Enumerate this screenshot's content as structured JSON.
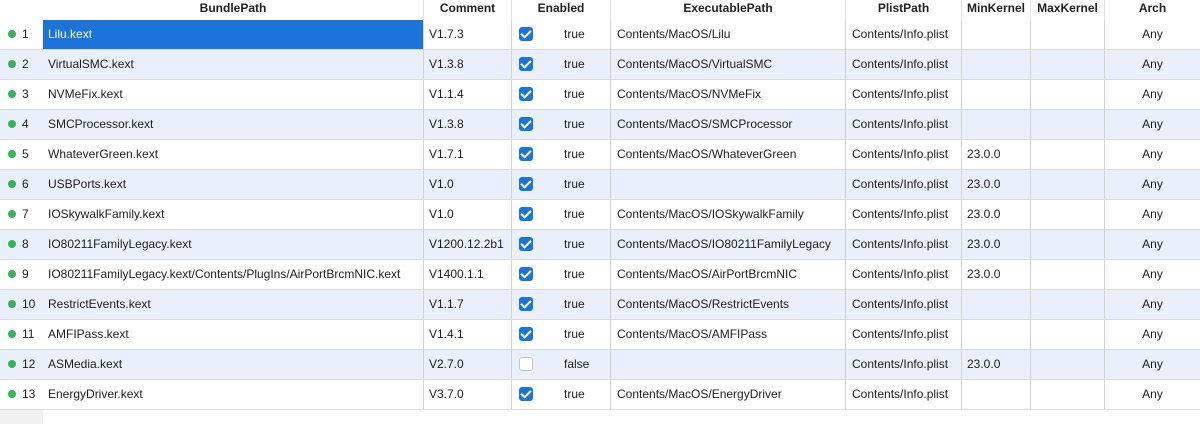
{
  "columns": [
    "BundlePath",
    "Comment",
    "Enabled",
    "ExecutablePath",
    "PlistPath",
    "MinKernel",
    "MaxKernel",
    "Arch"
  ],
  "rows": [
    {
      "index": "1",
      "bundle": "Lilu.kext",
      "comment": "V1.7.3",
      "enabled": true,
      "enabled_text": "true",
      "exec": "Contents/MacOS/Lilu",
      "plist": "Contents/Info.plist",
      "minkernel": "",
      "maxkernel": "",
      "arch": "Any"
    },
    {
      "index": "2",
      "bundle": "VirtualSMC.kext",
      "comment": "V1.3.8",
      "enabled": true,
      "enabled_text": "true",
      "exec": "Contents/MacOS/VirtualSMC",
      "plist": "Contents/Info.plist",
      "minkernel": "",
      "maxkernel": "",
      "arch": "Any"
    },
    {
      "index": "3",
      "bundle": "NVMeFix.kext",
      "comment": "V1.1.4",
      "enabled": true,
      "enabled_text": "true",
      "exec": "Contents/MacOS/NVMeFix",
      "plist": "Contents/Info.plist",
      "minkernel": "",
      "maxkernel": "",
      "arch": "Any"
    },
    {
      "index": "4",
      "bundle": "SMCProcessor.kext",
      "comment": "V1.3.8",
      "enabled": true,
      "enabled_text": "true",
      "exec": "Contents/MacOS/SMCProcessor",
      "plist": "Contents/Info.plist",
      "minkernel": "",
      "maxkernel": "",
      "arch": "Any"
    },
    {
      "index": "5",
      "bundle": "WhateverGreen.kext",
      "comment": "V1.7.1",
      "enabled": true,
      "enabled_text": "true",
      "exec": "Contents/MacOS/WhateverGreen",
      "plist": "Contents/Info.plist",
      "minkernel": "23.0.0",
      "maxkernel": "",
      "arch": "Any"
    },
    {
      "index": "6",
      "bundle": "USBPorts.kext",
      "comment": "V1.0",
      "enabled": true,
      "enabled_text": "true",
      "exec": "",
      "plist": "Contents/Info.plist",
      "minkernel": "23.0.0",
      "maxkernel": "",
      "arch": "Any"
    },
    {
      "index": "7",
      "bundle": "IOSkywalkFamily.kext",
      "comment": "V1.0",
      "enabled": true,
      "enabled_text": "true",
      "exec": "Contents/MacOS/IOSkywalkFamily",
      "plist": "Contents/Info.plist",
      "minkernel": "23.0.0",
      "maxkernel": "",
      "arch": "Any"
    },
    {
      "index": "8",
      "bundle": "IO80211FamilyLegacy.kext",
      "comment": "V1200.12.2b1",
      "enabled": true,
      "enabled_text": "true",
      "exec": "Contents/MacOS/IO80211FamilyLegacy",
      "plist": "Contents/Info.plist",
      "minkernel": "23.0.0",
      "maxkernel": "",
      "arch": "Any"
    },
    {
      "index": "9",
      "bundle": "IO80211FamilyLegacy.kext/Contents/PlugIns/AirPortBrcmNIC.kext",
      "comment": "V1400.1.1",
      "enabled": true,
      "enabled_text": "true",
      "exec": "Contents/MacOS/AirPortBrcmNIC",
      "plist": "Contents/Info.plist",
      "minkernel": "23.0.0",
      "maxkernel": "",
      "arch": "Any"
    },
    {
      "index": "10",
      "bundle": "RestrictEvents.kext",
      "comment": "V1.1.7",
      "enabled": true,
      "enabled_text": "true",
      "exec": "Contents/MacOS/RestrictEvents",
      "plist": "Contents/Info.plist",
      "minkernel": "",
      "maxkernel": "",
      "arch": "Any"
    },
    {
      "index": "11",
      "bundle": "AMFIPass.kext",
      "comment": "V1.4.1",
      "enabled": true,
      "enabled_text": "true",
      "exec": "Contents/MacOS/AMFIPass",
      "plist": "Contents/Info.plist",
      "minkernel": "",
      "maxkernel": "",
      "arch": "Any"
    },
    {
      "index": "12",
      "bundle": "ASMedia.kext",
      "comment": "V2.7.0",
      "enabled": false,
      "enabled_text": "false",
      "exec": "",
      "plist": "Contents/Info.plist",
      "minkernel": "23.0.0",
      "maxkernel": "",
      "arch": "Any"
    },
    {
      "index": "13",
      "bundle": "EnergyDriver.kext",
      "comment": "V3.7.0",
      "enabled": true,
      "enabled_text": "true",
      "exec": "Contents/MacOS/EnergyDriver",
      "plist": "Contents/Info.plist",
      "minkernel": "",
      "maxkernel": "",
      "arch": "Any"
    }
  ],
  "selected_row": 0,
  "colors": {
    "accent": "#1a74d9",
    "status_dot": "#34b55a",
    "row_alt": "#eaf0fb"
  }
}
